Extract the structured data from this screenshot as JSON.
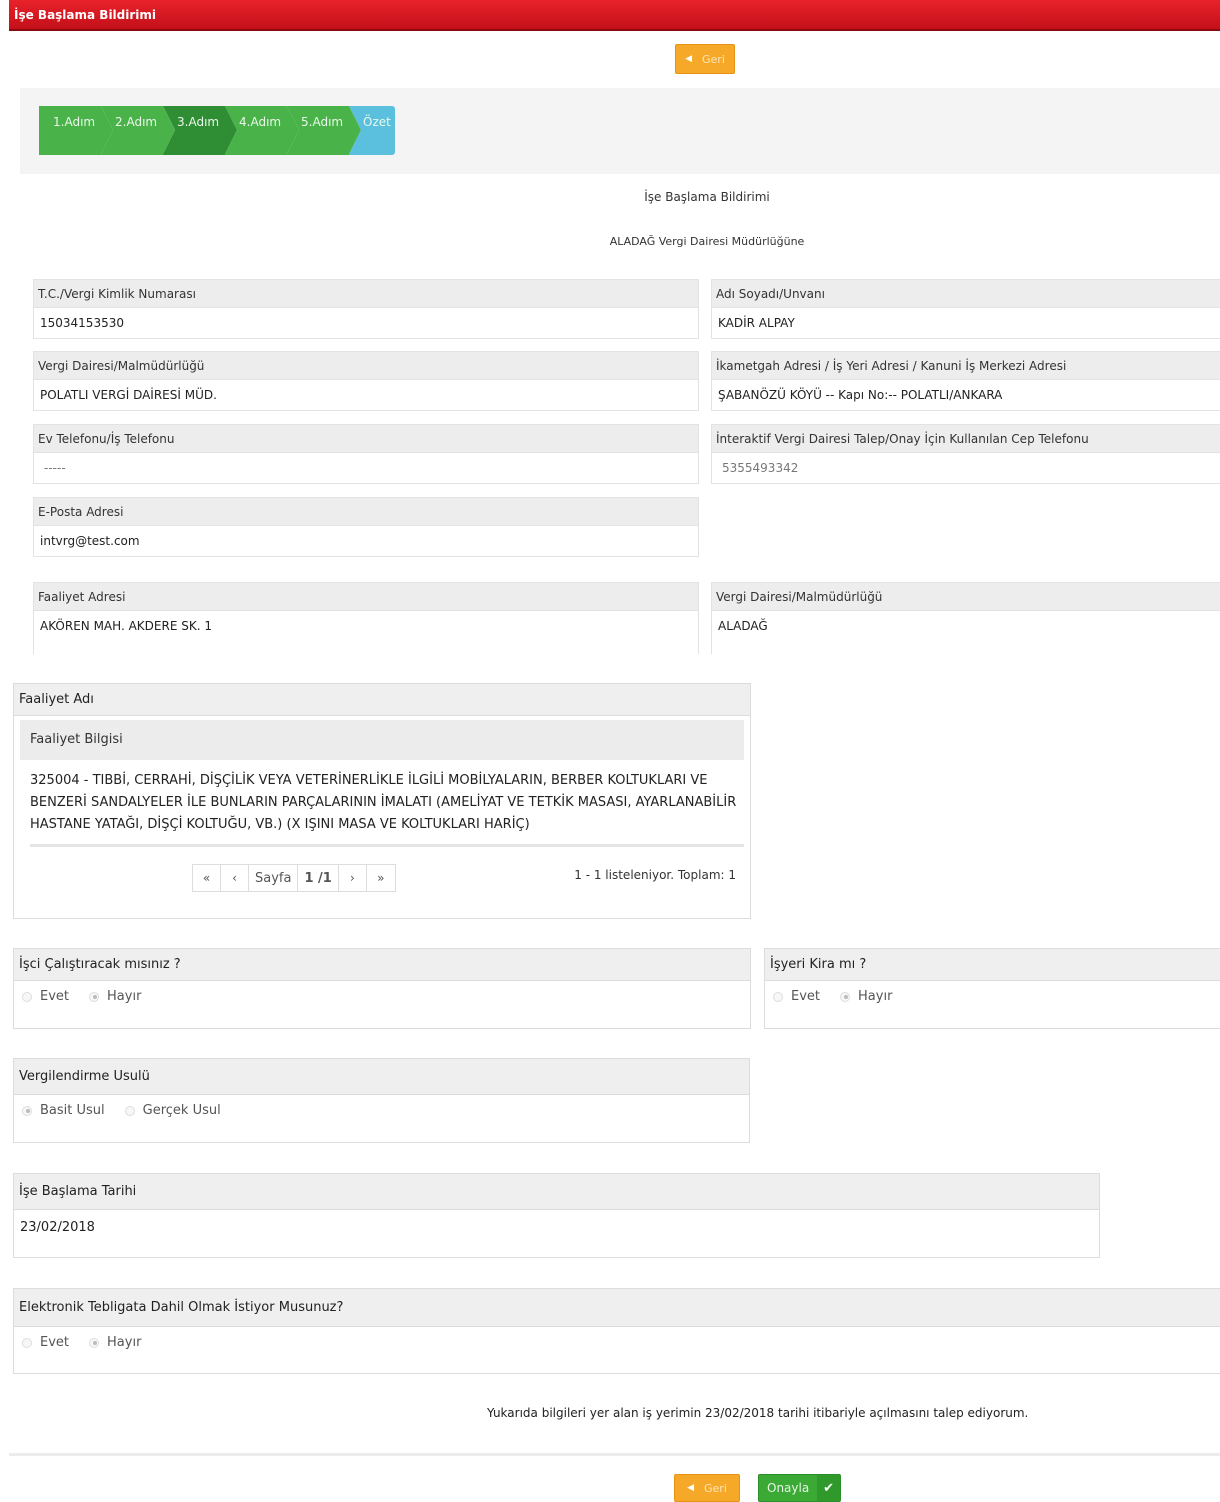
{
  "window": {
    "title": "İşe Başlama Bildirimi"
  },
  "top_back": {
    "label": "Geri",
    "icon": "chevron-left-icon"
  },
  "steps": [
    "1.Adım",
    "2.Adım",
    "3.Adım",
    "4.Adım",
    "5.Adım",
    "Özet"
  ],
  "form_title": "İşe Başlama Bildirimi",
  "office_heading": "ALADAĞ Vergi Dairesi Müdürlüğüne",
  "fields": {
    "tc": {
      "label": "T.C./Vergi Kimlik Numarası",
      "value": "15034153530"
    },
    "name": {
      "label": "Adı Soyadı/Unvanı",
      "value": "KADİR ALPAY"
    },
    "tax_office": {
      "label": "Vergi Dairesi/Malmüdürlüğü",
      "value": "POLATLI VERGİ DAİRESİ MÜD."
    },
    "address": {
      "label": "İkametgah Adresi / İş Yeri Adresi / Kanuni İş Merkezi Adresi",
      "value": "ŞABANÖZÜ KÖYÜ -- Kapı No:-- POLATLI/ANKARA"
    },
    "phone": {
      "label": "Ev Telefonu/İş Telefonu",
      "value": "-----"
    },
    "mobile": {
      "label": "İnteraktif Vergi Dairesi Talep/Onay İçin Kullanılan Cep Telefonu",
      "value": "5355493342"
    },
    "email": {
      "label": "E-Posta Adresi",
      "value": "intvrg@test.com"
    },
    "activity_address": {
      "label": "Faaliyet Adresi",
      "value": "AKÖREN MAH. AKDERE SK. 1"
    },
    "activity_tax_office": {
      "label": "Vergi Dairesi/Malmüdürlüğü",
      "value": "ALADAĞ"
    }
  },
  "activity": {
    "title": "Faaliyet Adı",
    "info_header": "Faaliyet Bilgisi",
    "text": "325004 - TIBBİ, CERRAHİ, DİŞÇİLİK VEYA VETERİNERLİKLE İLGİLİ MOBİLYALARIN, BERBER KOLTUKLARI VE BENZERİ SANDALYELER İLE BUNLARIN PARÇALARININ İMALATI (AMELİYAT VE TETKİK MASASI, AYARLANABİLİR HASTANE YATAĞI, DİŞÇİ KOLTUĞU, VB.) (X IŞINI MASA VE KOLTUKLARI HARİÇ)",
    "pager": {
      "first": "«",
      "prev": "‹",
      "page_label": "Sayfa",
      "page_value": "1 /1",
      "next": "›",
      "last": "»"
    },
    "count_text": "1 - 1 listeleniyor. Toplam: 1"
  },
  "worker_q": {
    "title": "İşci Çalıştıracak mısınız ?",
    "options": [
      "Evet",
      "Hayır"
    ],
    "selected": "Hayır"
  },
  "rent_q": {
    "title": "İşyeri Kira mı ?",
    "options": [
      "Evet",
      "Hayır"
    ],
    "selected": "Hayır"
  },
  "tax_method": {
    "title": "Vergilendirme Usulü",
    "options": [
      "Basit Usul",
      "Gerçek Usul"
    ],
    "selected": "Basit Usul"
  },
  "start_date": {
    "title": "İşe Başlama Tarihi",
    "value": "23/02/2018"
  },
  "e_notify": {
    "title": "Elektronik Tebligata Dahil Olmak İstiyor Musunuz?",
    "options": [
      "Evet",
      "Hayır"
    ],
    "selected": "Hayır"
  },
  "declaration": "Yukarıda bilgileri yer alan iş yerimin 23/02/2018 tarihi itibariyle açılmasını talep ediyorum.",
  "bottom": {
    "back_label": "Geri",
    "confirm_label": "Onayla"
  },
  "colors": {
    "titlebar": "#d7171f",
    "step": "#49b349",
    "step_active": "#2f8e34",
    "step_summary": "#5bc0de",
    "back_btn": "#f6a929",
    "confirm_btn": "#3aaa35"
  }
}
